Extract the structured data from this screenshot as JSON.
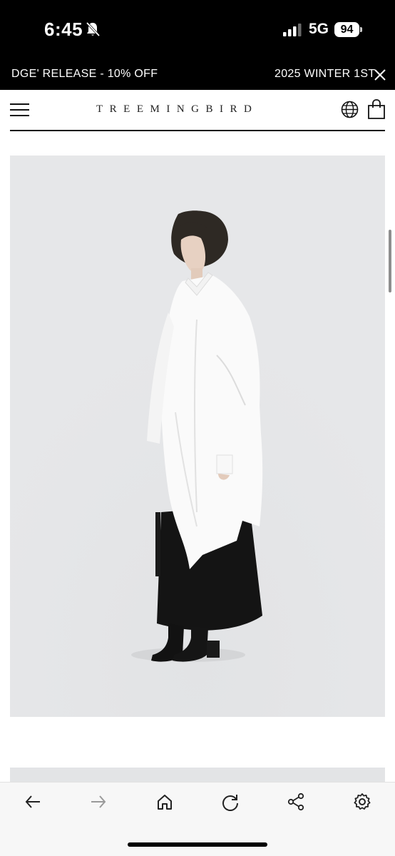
{
  "status_bar": {
    "time": "6:45",
    "network": "5G",
    "battery": "94"
  },
  "announcement": {
    "left_text": "DGE' RELEASE - 10% OFF",
    "right_text": "2025 WINTER 1ST"
  },
  "header": {
    "brand": "TREEMINGBIRD"
  },
  "icons": {
    "status": [
      "bell-muted-icon",
      "signal-icon"
    ],
    "header": [
      "menu-icon",
      "globe-icon",
      "shopping-bag-icon"
    ],
    "announcement": [
      "close-icon"
    ],
    "toolbar": [
      "back-arrow-icon",
      "forward-arrow-icon",
      "home-icon",
      "reload-icon",
      "share-icon",
      "settings-icon"
    ]
  },
  "colors": {
    "bar_background": "#000000",
    "image_background": "#e4e5e7",
    "toolbar_background": "#f7f7f7"
  }
}
